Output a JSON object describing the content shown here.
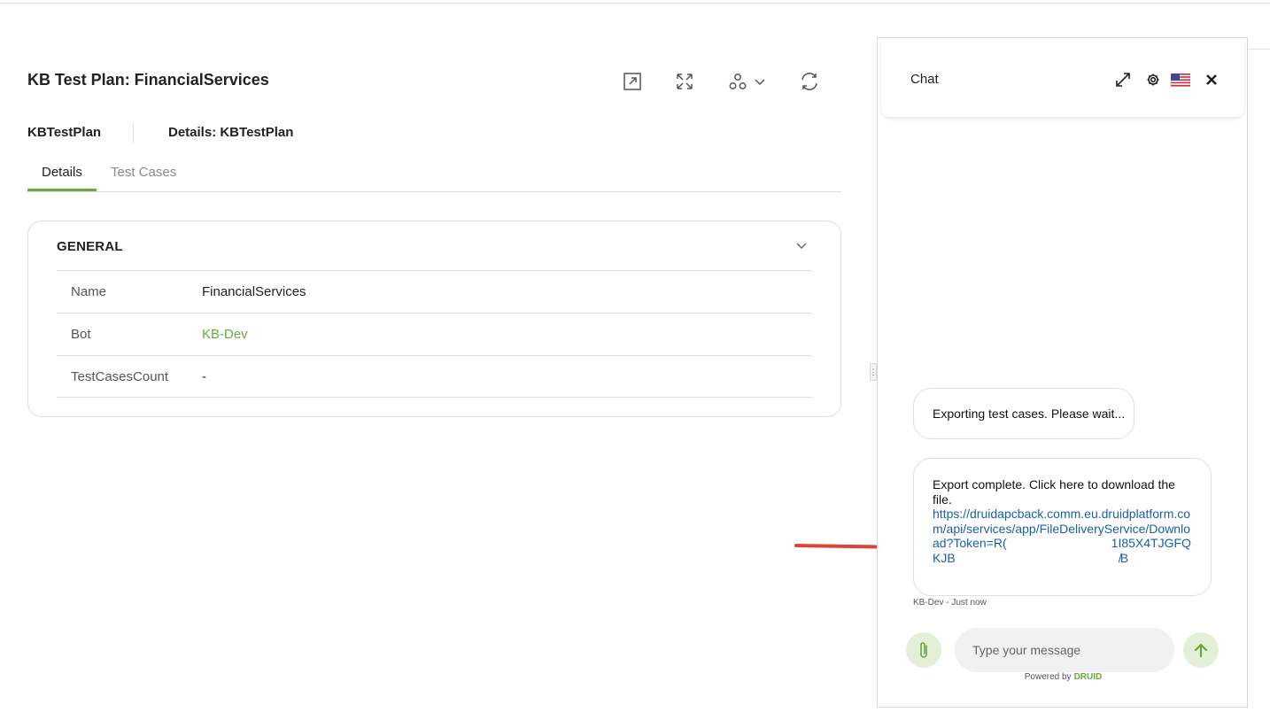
{
  "main": {
    "title": "KB Test Plan: FinancialServices",
    "subheader": {
      "name": "KBTestPlan",
      "details": "Details: KBTestPlan"
    },
    "tabs": [
      {
        "label": "Details",
        "active": true
      },
      {
        "label": "Test Cases",
        "active": false
      }
    ],
    "general": {
      "title": "GENERAL",
      "rows": [
        {
          "key": "Name",
          "value": "FinancialServices"
        },
        {
          "key": "Bot",
          "value": "KB-Dev"
        },
        {
          "key": "TestCasesCount",
          "value": "-"
        }
      ]
    },
    "toolbar_icons": [
      "open-external-icon",
      "fullscreen-icon",
      "nodes-icon",
      "chevron-down-icon",
      "refresh-icon"
    ]
  },
  "chat": {
    "title": "Chat",
    "header_icons": [
      "expand-icon",
      "gear-icon",
      "us-flag-icon",
      "close-icon"
    ],
    "messages": [
      {
        "text": "Exporting test cases. Please wait..."
      },
      {
        "text": "Export complete. Click here to download the file.",
        "link_part1": "https://druidapcback.comm.eu.druidplatform.com/api/services/app/FileDeliveryService/Download?Token=R(",
        "link_part2": "1I85X4TJGFQKJB",
        "link_part3": "̸B"
      }
    ],
    "meta_sender": "KB-Dev",
    "meta_time": " - Just now",
    "input_placeholder": "Type your message",
    "powered_by": "Powered by",
    "brand": "DRUID"
  },
  "colors": {
    "accent": "#6aa83a",
    "link": "#1a5fa8",
    "arrow": "#e0413a"
  }
}
